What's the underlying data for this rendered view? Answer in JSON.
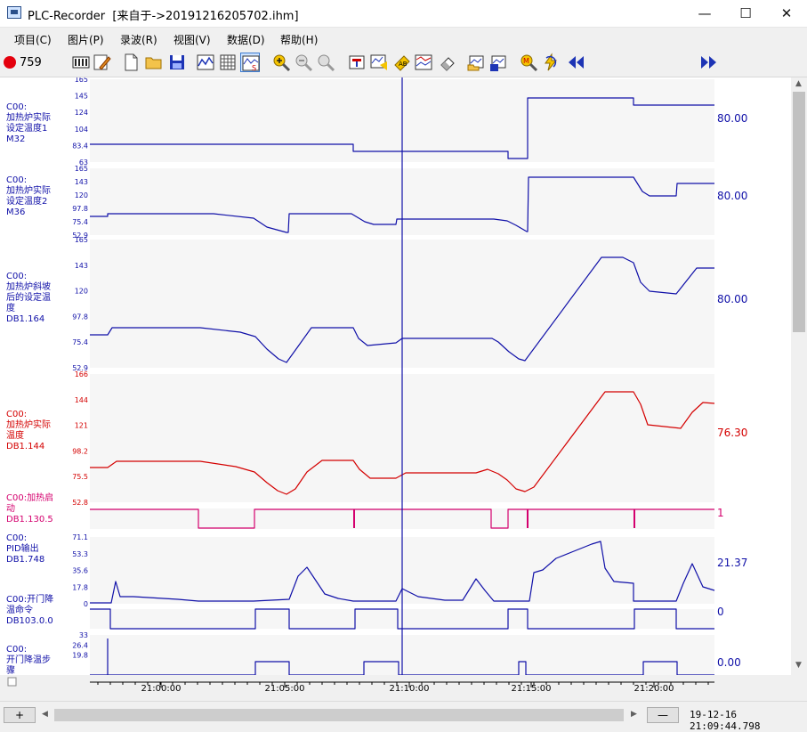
{
  "window": {
    "title": "PLC-Recorder  [来自于->20191216205702.ihm]",
    "minimize": "—",
    "maximize": "☐",
    "close": "✕"
  },
  "menu": [
    "项目(C)",
    "图片(P)",
    "录波(R)",
    "视图(V)",
    "数据(D)",
    "帮助(H)"
  ],
  "toolbar": {
    "record_count": "759",
    "colors": {
      "record": "#e4000d",
      "blue": "#1d34b5",
      "yellow": "#f5c400"
    }
  },
  "channels": [
    {
      "name": "C00:\n加热炉实际\n设定温度1\nM32",
      "ticks": [
        "165",
        "145",
        "124",
        "104",
        "83.4",
        "63"
      ],
      "value": "80.00",
      "color": "#1010a8"
    },
    {
      "name": "C00:\n加热炉实际\n设定温度2\nM36",
      "ticks": [
        "165",
        "143",
        "120",
        "97.8",
        "75.4",
        "52.9"
      ],
      "value": "80.00",
      "color": "#1010a8"
    },
    {
      "name": "C00:\n加热炉斜坡\n后的设定温\n度\nDB1.164",
      "ticks": [
        "165",
        "143",
        "120",
        "97.8",
        "75.4",
        "52.9"
      ],
      "value": "80.00",
      "color": "#1010a8"
    },
    {
      "name": "C00:\n加热炉实际\n温度\nDB1.144",
      "ticks": [
        "166",
        "144",
        "121",
        "98.2",
        "75.5",
        "52.8"
      ],
      "value": "76.30",
      "color": "#d40000"
    },
    {
      "name": "C00:加热启\n动\nDB1.130.5",
      "ticks": [],
      "value": "1",
      "color": "#d4006e"
    },
    {
      "name": "C00:\nPID输出\nDB1.748",
      "ticks": [
        "71.1",
        "53.3",
        "35.6",
        "17.8",
        "0"
      ],
      "value": "21.37",
      "color": "#1010a8"
    },
    {
      "name": "C00:开门降\n温命令\nDB103.0.0",
      "ticks": [],
      "value": "0",
      "color": "#1010a8"
    },
    {
      "name": "C00:\n开门降温步\n骤",
      "ticks": [
        "33",
        "26.4",
        "19.8"
      ],
      "value": "0.00",
      "color": "#1010a8"
    }
  ],
  "time_axis": {
    "labels": [
      "21:00:00",
      "21:05:00",
      "21:10:00",
      "21:15:00",
      "21:20:00"
    ]
  },
  "status": {
    "plus": "+",
    "minus": "—",
    "timestamp": "19-12-16 21:09:44.798"
  }
}
